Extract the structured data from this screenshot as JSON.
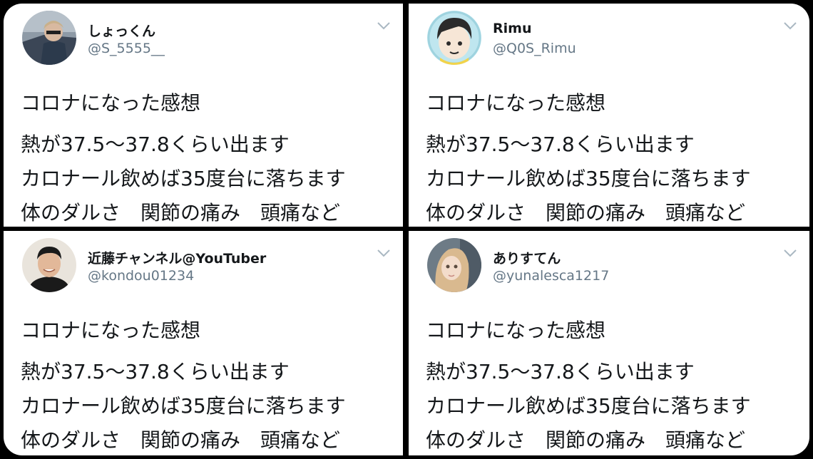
{
  "tweets": [
    {
      "name": "しょっくん",
      "handle": "@S_5555__",
      "lines": [
        "コロナになった感想",
        "熱が37.5〜37.8くらい出ます",
        "カロナール飲めば35度台に落ちます",
        "体のダルさ　関節の痛み　頭痛など"
      ],
      "avatar_colors": {
        "bg": "#8e9aa6",
        "accent": "#2c3a4c"
      }
    },
    {
      "name": "Rimu",
      "handle": "@Q0S_Rimu",
      "lines": [
        "コロナになった感想",
        "熱が37.5〜37.8くらい出ます",
        "カロナール飲めば35度台に落ちます",
        "体のダルさ　関節の痛み　頭痛など"
      ],
      "avatar_colors": {
        "bg": "#bfe6ef",
        "accent": "#2b2b2b"
      }
    },
    {
      "name": "近藤チャンネル@YouTuber",
      "handle": "@kondou01234",
      "lines": [
        "コロナになった感想",
        "熱が37.5〜37.8くらい出ます",
        "カロナール飲めば35度台に落ちます",
        "体のダルさ　関節の痛み　頭痛など"
      ],
      "avatar_colors": {
        "bg": "#e9e4dc",
        "accent": "#1a1a1a"
      }
    },
    {
      "name": "ありすてん",
      "handle": "@yunalesca1217",
      "lines": [
        "コロナになった感想",
        "熱が37.5〜37.8くらい出ます",
        "カロナール飲めば35度台に落ちます",
        "体のダルさ　関節の痛み　頭痛など"
      ],
      "avatar_colors": {
        "bg": "#6d7b86",
        "accent": "#d9b98f"
      }
    }
  ],
  "icons": {
    "avatar": "avatar-photo",
    "menu": "chevron-down-icon"
  },
  "colors": {
    "text": "#14171a",
    "handle": "#657786",
    "caret": "#aab8c2",
    "frame": "#000000"
  }
}
